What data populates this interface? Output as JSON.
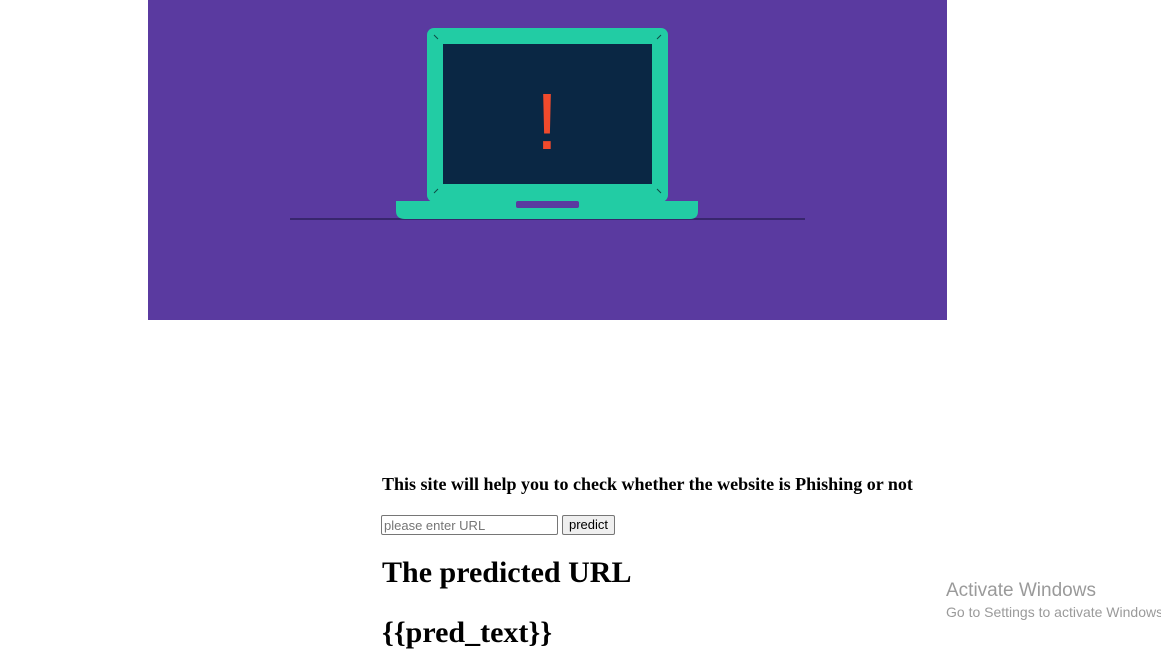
{
  "hero": {
    "background_color": "#5a3aa0",
    "laptop_color": "#22cca4",
    "screen_color": "#0a2744",
    "alert_color": "#f04a2c",
    "alert_symbol": "!"
  },
  "form": {
    "headline": "This site will help you to check whether the website is Phishing or not",
    "url_placeholder": "please enter URL",
    "url_value": "",
    "predict_label": "predict"
  },
  "result": {
    "heading": "The predicted URL",
    "value": "{{pred_text}}"
  },
  "watermark": {
    "title": "Activate Windows",
    "subtitle": "Go to Settings to activate Windows."
  }
}
